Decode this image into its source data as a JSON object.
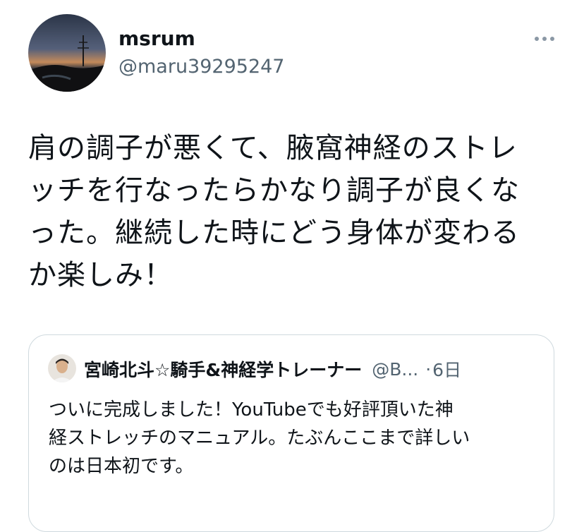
{
  "tweet": {
    "author": {
      "display_name": "msrum",
      "handle": "@maru39295247"
    },
    "more_icon": "more-dots-icon",
    "text": "肩の調子が悪くて、腋窩神経のストレ\nッチを行なったらかなり調子が良くな\nった。継続した時にどう身体が変わる\nか楽しみ！"
  },
  "quoted_tweet": {
    "display_name": "宮崎北斗☆騎手&神経学トレーナー",
    "handle": "@B...",
    "separator": "·",
    "time": "6日",
    "text": "ついに完成しました！YouTubeでも好評頂いた神\n経ストレッチのマニュアル。たぶんここまで詳しい\nのは日本初です。"
  },
  "colors": {
    "text_primary": "#0f1419",
    "text_secondary": "#536471",
    "border": "#cfd9de"
  }
}
